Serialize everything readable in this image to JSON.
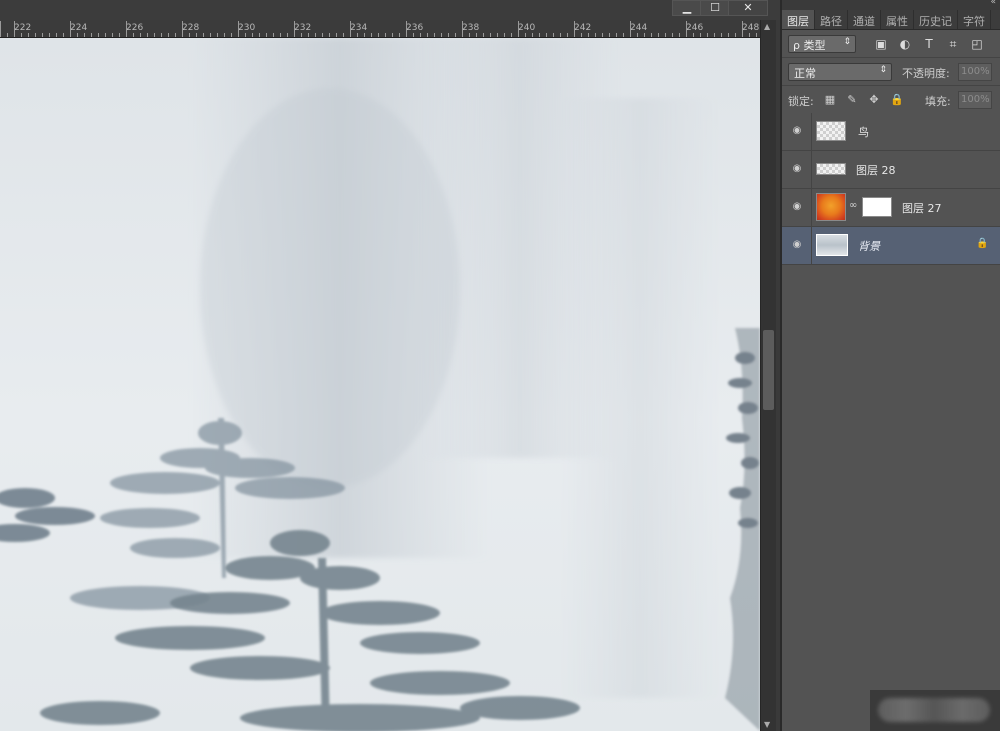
{
  "window": {
    "min_glyph": "▁",
    "max_glyph": "☐",
    "close_glyph": "✕"
  },
  "ruler": {
    "ticks": [
      "222",
      "224",
      "226",
      "228",
      "230",
      "232",
      "234",
      "236",
      "238",
      "240",
      "242",
      "244",
      "246",
      "248"
    ]
  },
  "scrollbar": {
    "up_glyph": "▲",
    "down_glyph": "▼"
  },
  "panel": {
    "collapse_glyph": "«",
    "tabs": [
      {
        "label": "图层",
        "active": true
      },
      {
        "label": "路径"
      },
      {
        "label": "通道"
      },
      {
        "label": "属性"
      },
      {
        "label": "历史记"
      },
      {
        "label": "字符"
      }
    ],
    "filter": {
      "label": "ρ 类型",
      "arrow": "⇕",
      "icons": [
        "image-filter-icon",
        "adjustment-filter-icon",
        "type-filter-icon",
        "shape-filter-icon",
        "smart-object-filter-icon"
      ],
      "icon_glyphs": [
        "▣",
        "◐",
        "T",
        "⌗",
        "◰"
      ]
    },
    "blend": {
      "value": "正常",
      "arrow": "⇕",
      "opacity_label": "不透明度:",
      "opacity_value": "100%"
    },
    "lock": {
      "label": "锁定:",
      "fill_label": "填充:",
      "fill_value": "100%",
      "icon_glyphs": [
        "▦",
        "✎",
        "✥",
        "🔒"
      ]
    },
    "layers": [
      {
        "name": "鸟",
        "type": "checker",
        "selected": false
      },
      {
        "name": "图层 28",
        "type": "checker-strip",
        "selected": false
      },
      {
        "name": "图层 27",
        "type": "gradient-mask",
        "selected": false
      },
      {
        "name": "背景",
        "type": "image",
        "selected": true,
        "locked": true,
        "lock_glyph": "🔒"
      }
    ],
    "eye_glyph": "◉"
  },
  "colors": {
    "panel_bg": "#535353",
    "selected_layer": "#566174",
    "canvas_bg": "#e4e8ea"
  }
}
